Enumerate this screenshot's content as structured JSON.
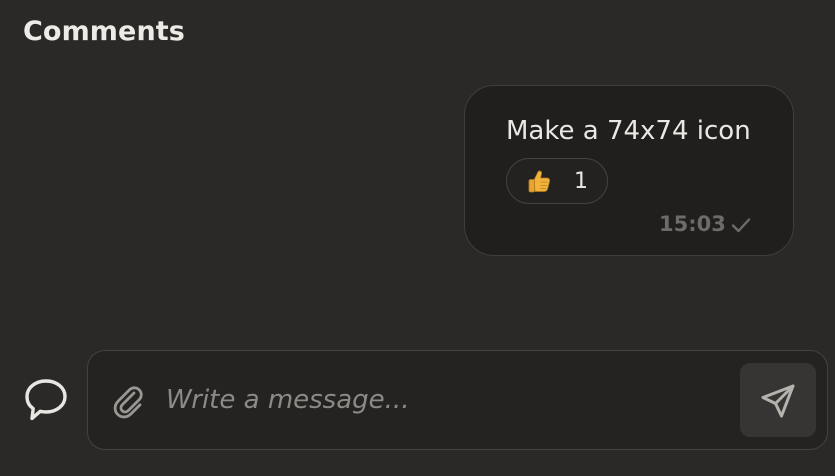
{
  "header": {
    "title": "Comments"
  },
  "message": {
    "text": "Make a 74x74 icon",
    "reaction": {
      "emoji_icon": "thumbs-up-icon",
      "count": "1"
    },
    "time": "15:03",
    "status_icon": "check-icon"
  },
  "composer": {
    "placeholder": "Write a message...",
    "value": "",
    "left_icon": "comment-icon",
    "attach_icon": "paperclip-icon",
    "send_icon": "send-icon"
  },
  "colors": {
    "background": "#2a2928",
    "bubble": "#201f1e",
    "composer": "#242322",
    "send_button": "#363533",
    "text": "#ebe8e4",
    "muted": "#6d6b68",
    "emoji": "#f2b33d"
  }
}
